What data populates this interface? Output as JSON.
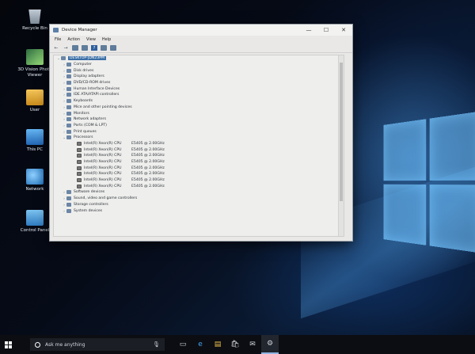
{
  "desktop": {
    "icons": [
      {
        "label": "Recycle Bin",
        "icon": "recycle-bin-icon"
      },
      {
        "label": "3D Vision Photo Viewer",
        "icon": "3d-vision-icon"
      },
      {
        "label": "User",
        "icon": "user-folder-icon"
      },
      {
        "label": "This PC",
        "icon": "this-pc-icon"
      },
      {
        "label": "Network",
        "icon": "network-icon"
      },
      {
        "label": "Control Panel",
        "icon": "control-panel-icon"
      }
    ]
  },
  "window": {
    "title": "Device Manager",
    "controls": {
      "minimize": "—",
      "maximize": "☐",
      "close": "✕"
    },
    "menu": [
      "File",
      "Action",
      "View",
      "Help"
    ],
    "tree": {
      "root": "DESKTOP-JDN23PM",
      "categories_before": [
        "Computer",
        "Disk drives",
        "Display adapters",
        "DVD/CD-ROM drives",
        "Human Interface Devices",
        "IDE ATA/ATAPI controllers",
        "Keyboards",
        "Mice and other pointing devices",
        "Monitors",
        "Network adapters",
        "Ports (COM & LPT)",
        "Print queues",
        "Processors"
      ],
      "processors": [
        {
          "name": "Intel(R) Xeon(R) CPU",
          "model": "E5405  @ 2.00GHz"
        },
        {
          "name": "Intel(R) Xeon(R) CPU",
          "model": "E5405  @ 2.00GHz"
        },
        {
          "name": "Intel(R) Xeon(R) CPU",
          "model": "E5405  @ 2.00GHz"
        },
        {
          "name": "Intel(R) Xeon(R) CPU",
          "model": "E5405  @ 2.00GHz"
        },
        {
          "name": "Intel(R) Xeon(R) CPU",
          "model": "E5405  @ 2.00GHz"
        },
        {
          "name": "Intel(R) Xeon(R) CPU",
          "model": "E5405  @ 2.00GHz"
        },
        {
          "name": "Intel(R) Xeon(R) CPU",
          "model": "E5405  @ 2.00GHz"
        },
        {
          "name": "Intel(R) Xeon(R) CPU",
          "model": "E5405  @ 2.00GHz"
        }
      ],
      "categories_after": [
        "Software devices",
        "Sound, video and game controllers",
        "Storage controllers",
        "System devices"
      ]
    }
  },
  "taskbar": {
    "search_placeholder": "Ask me anything",
    "icons": [
      "task-view-icon",
      "edge-icon",
      "file-explorer-icon",
      "store-icon",
      "mail-icon",
      "device-manager-icon"
    ]
  },
  "colors": {
    "selection": "#3a6ea5",
    "accent": "#8fb4e0"
  }
}
